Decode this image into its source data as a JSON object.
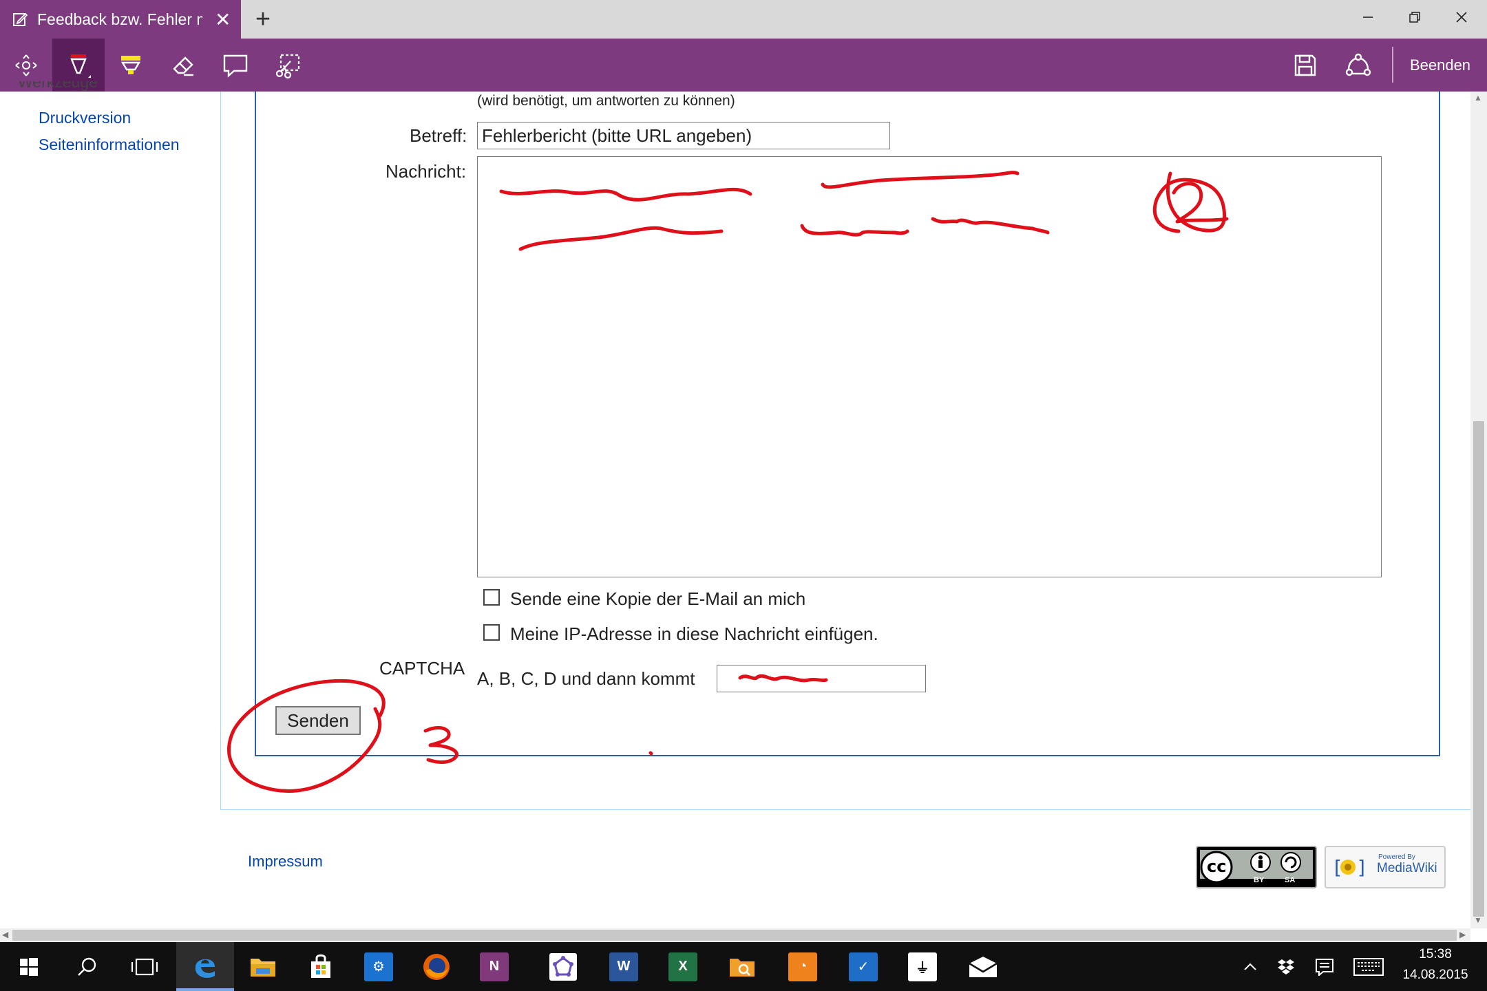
{
  "browser": {
    "tab_title": "Feedback bzw. Fehler m",
    "new_tab_icon": "plus-icon",
    "window_buttons": [
      "minimize-icon",
      "restore-icon",
      "close-icon"
    ]
  },
  "ink_toolbar": {
    "tools": [
      "pan-icon",
      "pen-icon",
      "highlighter-icon",
      "eraser-icon",
      "comment-icon",
      "clip-icon"
    ],
    "selected_tool": "pen-icon",
    "save_icon": "save-icon",
    "share_icon": "share-icon",
    "exit_label": "Beenden"
  },
  "sidebar": {
    "partial_heading": "Werkzeuge",
    "links": [
      "Druckversion",
      "Seiteninformationen"
    ]
  },
  "form": {
    "email_hint": "(wird benötigt, um antworten zu können)",
    "subject_label": "Betreff:",
    "subject_value": "Fehlerbericht (bitte URL angeben)",
    "message_label": "Nachricht:",
    "checkbox_copy_label": "Sende eine Kopie der E-Mail an mich",
    "checkbox_ip_label": "Meine IP-Adresse in diese Nachricht einfügen.",
    "checkbox_copy_checked": false,
    "checkbox_ip_checked": false,
    "captcha_label": "CAPTCHA",
    "captcha_question": "A, B, C, D und dann kommt",
    "submit_label": "Senden"
  },
  "ink_annotations": {
    "numeral_message": "2",
    "numeral_submit": "3",
    "ink_color": "#e0101a"
  },
  "footer": {
    "impressum_label": "Impressum",
    "cc_badge": {
      "cc": "cc",
      "by": "BY",
      "sa": "SA"
    },
    "mediawiki_badge": {
      "line1": "Powered By",
      "line2": "MediaWiki"
    }
  },
  "taskbar": {
    "apps": [
      "windows-start-icon",
      "search-icon",
      "task-view-icon",
      "edge-icon",
      "file-explorer-icon",
      "store-icon",
      "settings-icon",
      "firefox-icon",
      "onenote-icon",
      "app-icon",
      "word-icon",
      "excel-icon",
      "search-folder-icon",
      "pdf-icon",
      "tasks-icon",
      "usb-icon",
      "mail-icon"
    ],
    "onenote_letter": "N",
    "word_letter": "W",
    "excel_letter": "X",
    "tray_icons": [
      "chevron-up-icon",
      "dropbox-icon",
      "action-center-icon",
      "keyboard-icon"
    ],
    "time": "15:38",
    "date": "14.08.2015"
  },
  "colors": {
    "accent_purple": "#7d3a7f",
    "link_blue": "#0645ad",
    "form_border_blue": "#2a5ca8",
    "ink_red": "#e0101a"
  }
}
